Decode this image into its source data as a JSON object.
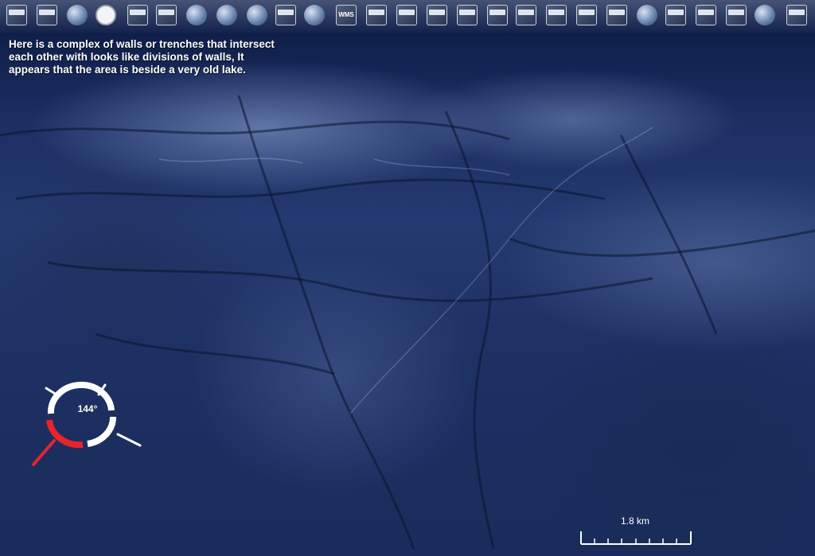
{
  "annotation": {
    "line1": "Here is a complex of walls or trenches that intersect",
    "line2": "each other with looks like divisions of walls,  It",
    "line3": "appears that the area is beside a very old lake."
  },
  "compass": {
    "heading": "144°"
  },
  "scale": {
    "label": "1.8 km"
  },
  "toolbar": {
    "items": [
      {
        "icon": "layers-icon"
      },
      {
        "icon": "grid-icon"
      },
      {
        "icon": "globe-grid-icon"
      },
      {
        "icon": "clock-icon"
      },
      {
        "icon": "placemark-icon"
      },
      {
        "icon": "search-icon"
      },
      {
        "icon": "earth-icon"
      },
      {
        "icon": "moon-icon"
      },
      {
        "icon": "mars-icon"
      },
      {
        "icon": "add-layer-icon"
      },
      {
        "icon": "satellite-icon"
      },
      {
        "icon": "wms-icon",
        "text": "WMS"
      },
      {
        "icon": "weather-map-icon"
      },
      {
        "icon": "layer-thumbnail-icon"
      },
      {
        "icon": "layer-thumbnail-icon"
      },
      {
        "icon": "layer-thumbnail-icon"
      },
      {
        "icon": "layer-thumbnail-icon"
      },
      {
        "icon": "layer-thumbnail-icon"
      },
      {
        "icon": "layer-thumbnail-icon"
      },
      {
        "icon": "layer-thumbnail-icon"
      },
      {
        "icon": "layer-thumbnail-icon"
      },
      {
        "icon": "globe-overview-icon"
      },
      {
        "icon": "map-thumbnail-icon"
      },
      {
        "icon": "flags-icon"
      },
      {
        "icon": "flag-collage-icon"
      },
      {
        "icon": "world-wind-icon"
      },
      {
        "icon": "relief-globe-icon"
      },
      {
        "icon": "tools-icon"
      }
    ]
  }
}
